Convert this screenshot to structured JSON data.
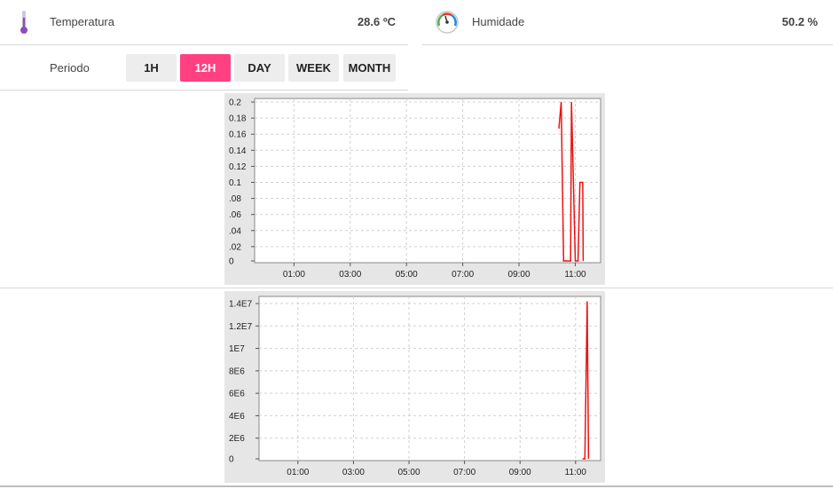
{
  "sensors": {
    "temperature": {
      "label": "Temperatura",
      "value": "28.6 ºC",
      "icon": "thermometer-icon"
    },
    "humidity": {
      "label": "Humidade",
      "value": "50.2 %",
      "icon": "hygrometer-icon"
    }
  },
  "period": {
    "label": "Periodo",
    "buttons": [
      "1H",
      "12H",
      "DAY",
      "WEEK",
      "MONTH"
    ],
    "active": "12H"
  },
  "colors": {
    "accent": "#ff4081",
    "series": "#ee1111"
  },
  "chart_data": [
    {
      "type": "line",
      "title": "",
      "xlabel": "",
      "ylabel": "",
      "x_ticks": [
        "01:00",
        "03:00",
        "05:00",
        "07:00",
        "09:00",
        "11:00"
      ],
      "y_ticks": [
        "0.2",
        "0.18",
        "0.16",
        "0.14",
        "0.12",
        "0.1",
        ".08",
        ".06",
        ".04",
        ".02",
        "0"
      ],
      "ylim": [
        0,
        0.2
      ],
      "xlim_hours": [
        23.6,
        11.9
      ],
      "grid": true,
      "series": [
        {
          "x": [
            "10:25",
            "10:30",
            "10:35",
            "10:50",
            "10:52",
            "11:00",
            "11:02",
            "11:06",
            "11:10",
            "11:12",
            "11:16",
            "11:17"
          ],
          "values": [
            0.167,
            0.2,
            0,
            0,
            0.2,
            0,
            0,
            0,
            0.1,
            0.1,
            0.1,
            0
          ]
        }
      ]
    },
    {
      "type": "line",
      "title": "",
      "xlabel": "",
      "ylabel": "",
      "x_ticks": [
        "01:00",
        "03:00",
        "05:00",
        "07:00",
        "09:00",
        "11:00"
      ],
      "y_ticks": [
        "1.4E7",
        "1.2E7",
        "1E7",
        "8E6",
        "6E6",
        "4E6",
        "2E6",
        "0"
      ],
      "ylim": [
        0,
        14000000
      ],
      "grid": true,
      "series": [
        {
          "x": [
            "11:15",
            "11:20",
            "11:25",
            "11:28"
          ],
          "values": [
            0,
            0,
            14200000,
            0
          ]
        }
      ]
    }
  ]
}
